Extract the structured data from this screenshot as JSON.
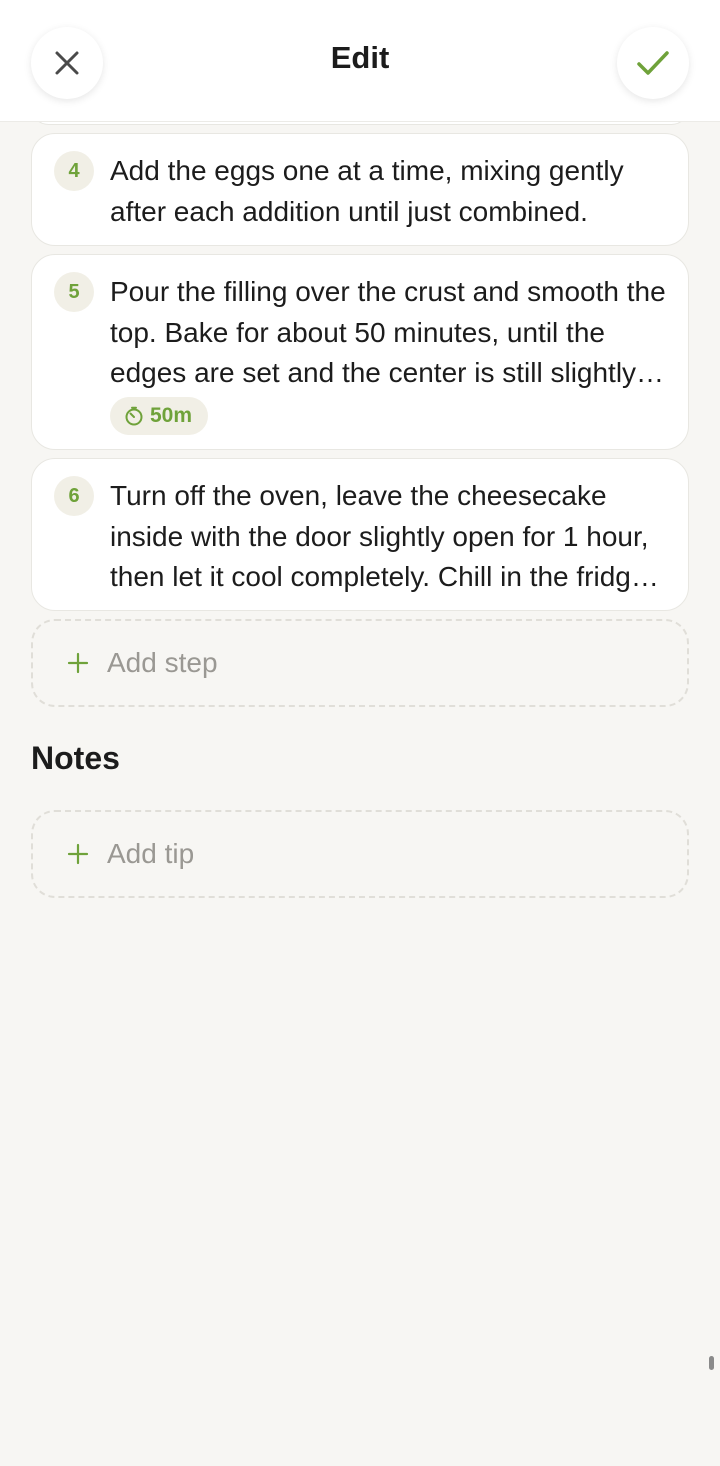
{
  "header": {
    "title": "Edit"
  },
  "steps": [
    {
      "number": "4",
      "lines": [
        "Add the eggs one at a time, mixing gently",
        "after each addition until just combined."
      ]
    },
    {
      "number": "5",
      "lines": [
        "Pour the filling over the crust and smooth the",
        "top. Bake for about 50 minutes, until the",
        "edges are set and the center is still slightly…"
      ],
      "timer": "50m"
    },
    {
      "number": "6",
      "lines": [
        "Turn off the oven, leave the cheesecake",
        "inside with the door slightly open for 1 hour,",
        "then let it cool completely. Chill in the fridg…"
      ]
    }
  ],
  "add_step_label": "Add step",
  "notes": {
    "title": "Notes",
    "add_tip_label": "Add tip"
  },
  "colors": {
    "accent": "#6fa23a",
    "background": "#f7f6f3"
  }
}
